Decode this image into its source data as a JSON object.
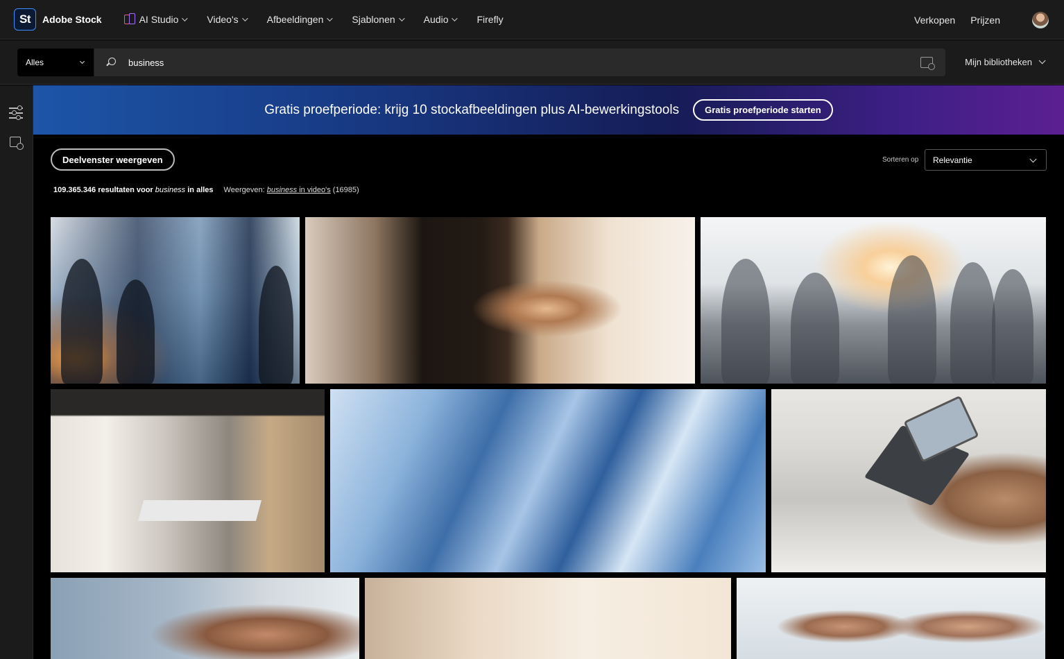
{
  "brand": {
    "badge": "St",
    "name": "Adobe Stock"
  },
  "nav": {
    "items": [
      {
        "label": "AI Studio",
        "dropdown": true,
        "icon": "ai-studio-icon"
      },
      {
        "label": "Video's",
        "dropdown": true
      },
      {
        "label": "Afbeeldingen",
        "dropdown": true
      },
      {
        "label": "Sjablonen",
        "dropdown": true
      },
      {
        "label": "Audio",
        "dropdown": true
      },
      {
        "label": "Firefly",
        "dropdown": false
      }
    ],
    "right": {
      "sell": "Verkopen",
      "pricing": "Prijzen"
    }
  },
  "search": {
    "scope": "Alles",
    "query": "business",
    "libraries": "Mijn bibliotheken"
  },
  "banner": {
    "text": "Gratis proefperiode: krijg 10 stockafbeeldingen plus AI-bewerkingstools",
    "button": "Gratis proefperiode starten"
  },
  "toolbar": {
    "panel_button": "Deelvenster weergeven",
    "sort_label": "Sorteren op",
    "sort_value": "Relevantie"
  },
  "results": {
    "count": "109.365.346 resultaten voor",
    "term": "business",
    "scope_suffix": "in alles",
    "view_prefix": "Weergeven:",
    "view_term": "business",
    "view_suffix": "in video's",
    "view_count": "(16985)"
  },
  "colors": {
    "nav_bg": "#1b1b1b",
    "page_bg": "#000000",
    "banner_start": "#1d55a8",
    "banner_end": "#5c1f92"
  }
}
